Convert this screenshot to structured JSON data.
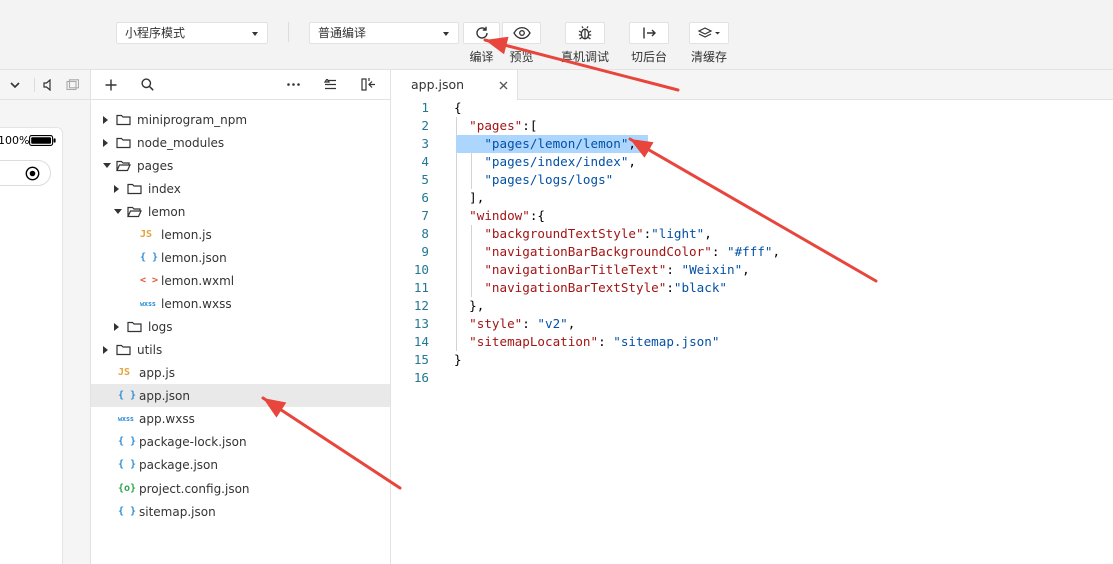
{
  "toolbar": {
    "mode_select": "小程序模式",
    "compile_select": "普通编译",
    "buttons": [
      {
        "label": "编译",
        "icon": "refresh-icon"
      },
      {
        "label": "预览",
        "icon": "eye-icon"
      },
      {
        "label": "真机调试",
        "icon": "bug-icon"
      },
      {
        "label": "切后台",
        "icon": "switch-background-icon"
      },
      {
        "label": "清缓存",
        "icon": "layers-icon"
      }
    ]
  },
  "simulator": {
    "battery_text": "100%"
  },
  "tree": {
    "items": [
      {
        "label": "miniprogram_npm",
        "type": "folder",
        "depth": 0,
        "state": "collapsed"
      },
      {
        "label": "node_modules",
        "type": "folder",
        "depth": 0,
        "state": "collapsed"
      },
      {
        "label": "pages",
        "type": "folder",
        "depth": 0,
        "state": "expanded"
      },
      {
        "label": "index",
        "type": "folder",
        "depth": 1,
        "state": "collapsed"
      },
      {
        "label": "lemon",
        "type": "folder",
        "depth": 1,
        "state": "expanded"
      },
      {
        "label": "lemon.js",
        "type": "js",
        "depth": 2
      },
      {
        "label": "lemon.json",
        "type": "json",
        "depth": 2
      },
      {
        "label": "lemon.wxml",
        "type": "wxml",
        "depth": 2
      },
      {
        "label": "lemon.wxss",
        "type": "wxss",
        "depth": 2
      },
      {
        "label": "logs",
        "type": "folder",
        "depth": 1,
        "state": "collapsed"
      },
      {
        "label": "utils",
        "type": "folder",
        "depth": 0,
        "state": "collapsed"
      },
      {
        "label": "app.js",
        "type": "js",
        "depth": 0
      },
      {
        "label": "app.json",
        "type": "json",
        "depth": 0,
        "selected": true
      },
      {
        "label": "app.wxss",
        "type": "wxss",
        "depth": 0
      },
      {
        "label": "package-lock.json",
        "type": "json",
        "depth": 0
      },
      {
        "label": "package.json",
        "type": "json",
        "depth": 0
      },
      {
        "label": "project.config.json",
        "type": "config",
        "depth": 0
      },
      {
        "label": "sitemap.json",
        "type": "json",
        "depth": 0
      }
    ],
    "icon_glyphs": {
      "js": "JS",
      "json": "{ }",
      "wxml": "< >",
      "wxss": "wxss",
      "config": "{o}"
    }
  },
  "editor": {
    "tab_label": "app.json",
    "highlighted_line": 3,
    "lines": [
      [
        {
          "t": "{",
          "c": "p"
        }
      ],
      [
        {
          "t": "  ",
          "c": "p"
        },
        {
          "t": "\"pages\"",
          "c": "s"
        },
        {
          "t": ":[",
          "c": "p"
        }
      ],
      [
        {
          "t": "    ",
          "c": "p"
        },
        {
          "t": "\"pages/lemon/lemon\"",
          "c": "v"
        },
        {
          "t": ",",
          "c": "p"
        }
      ],
      [
        {
          "t": "    ",
          "c": "p"
        },
        {
          "t": "\"pages/index/index\"",
          "c": "v"
        },
        {
          "t": ",",
          "c": "p"
        }
      ],
      [
        {
          "t": "    ",
          "c": "p"
        },
        {
          "t": "\"pages/logs/logs\"",
          "c": "v"
        }
      ],
      [
        {
          "t": "  ],",
          "c": "p"
        }
      ],
      [
        {
          "t": "  ",
          "c": "p"
        },
        {
          "t": "\"window\"",
          "c": "s"
        },
        {
          "t": ":{",
          "c": "p"
        }
      ],
      [
        {
          "t": "    ",
          "c": "p"
        },
        {
          "t": "\"backgroundTextStyle\"",
          "c": "s"
        },
        {
          "t": ":",
          "c": "p"
        },
        {
          "t": "\"light\"",
          "c": "v"
        },
        {
          "t": ",",
          "c": "p"
        }
      ],
      [
        {
          "t": "    ",
          "c": "p"
        },
        {
          "t": "\"navigationBarBackgroundColor\"",
          "c": "s"
        },
        {
          "t": ": ",
          "c": "p"
        },
        {
          "t": "\"#fff\"",
          "c": "v"
        },
        {
          "t": ",",
          "c": "p"
        }
      ],
      [
        {
          "t": "    ",
          "c": "p"
        },
        {
          "t": "\"navigationBarTitleText\"",
          "c": "s"
        },
        {
          "t": ": ",
          "c": "p"
        },
        {
          "t": "\"Weixin\"",
          "c": "v"
        },
        {
          "t": ",",
          "c": "p"
        }
      ],
      [
        {
          "t": "    ",
          "c": "p"
        },
        {
          "t": "\"navigationBarTextStyle\"",
          "c": "s"
        },
        {
          "t": ":",
          "c": "p"
        },
        {
          "t": "\"black\"",
          "c": "v"
        }
      ],
      [
        {
          "t": "  },",
          "c": "p"
        }
      ],
      [
        {
          "t": "  ",
          "c": "p"
        },
        {
          "t": "\"style\"",
          "c": "s"
        },
        {
          "t": ": ",
          "c": "p"
        },
        {
          "t": "\"v2\"",
          "c": "v"
        },
        {
          "t": ",",
          "c": "p"
        }
      ],
      [
        {
          "t": "  ",
          "c": "p"
        },
        {
          "t": "\"sitemapLocation\"",
          "c": "s"
        },
        {
          "t": ": ",
          "c": "p"
        },
        {
          "t": "\"sitemap.json\"",
          "c": "v"
        }
      ],
      [
        {
          "t": "}",
          "c": "p"
        }
      ],
      []
    ]
  },
  "colors": {
    "annotation_arrow": "#e8453c",
    "line_highlight": "#add6ff",
    "key_string": "#a31515",
    "value_string": "#0451a5",
    "line_number": "#237893",
    "js_icon": "#e6a23c",
    "json_icon": "#2e8fd6",
    "wxml_icon": "#e8553c",
    "wxss_icon": "#2e8fd6",
    "config_icon": "#2ea44f"
  }
}
